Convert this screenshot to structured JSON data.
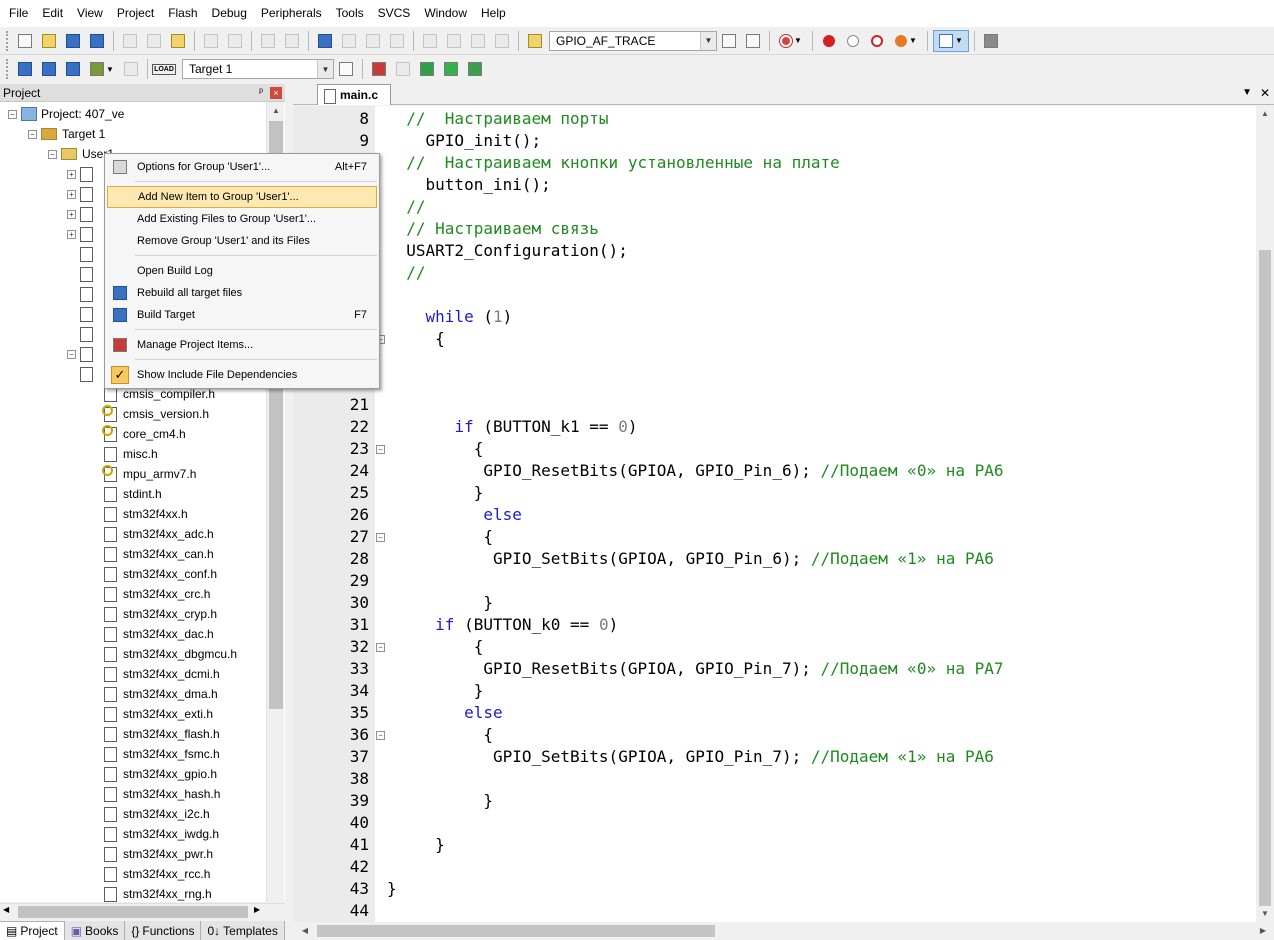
{
  "menu": [
    "File",
    "Edit",
    "View",
    "Project",
    "Flash",
    "Debug",
    "Peripherals",
    "Tools",
    "SVCS",
    "Window",
    "Help"
  ],
  "toolbar": {
    "find_combo": "GPIO_AF_TRACE",
    "target_combo": "Target 1",
    "load_label": "LOAD"
  },
  "project_panel": {
    "title": "Project",
    "pin_glyph": "ᵖ",
    "close_glyph": "×",
    "root": "Project: 407_ve",
    "target": "Target 1",
    "group": "User1",
    "files": [
      "cmsis_compiler.h",
      "cmsis_version.h",
      "core_cm4.h",
      "misc.h",
      "mpu_armv7.h",
      "stdint.h",
      "stm32f4xx.h",
      "stm32f4xx_adc.h",
      "stm32f4xx_can.h",
      "stm32f4xx_conf.h",
      "stm32f4xx_crc.h",
      "stm32f4xx_cryp.h",
      "stm32f4xx_dac.h",
      "stm32f4xx_dbgmcu.h",
      "stm32f4xx_dcmi.h",
      "stm32f4xx_dma.h",
      "stm32f4xx_exti.h",
      "stm32f4xx_flash.h",
      "stm32f4xx_fsmc.h",
      "stm32f4xx_gpio.h",
      "stm32f4xx_hash.h",
      "stm32f4xx_i2c.h",
      "stm32f4xx_iwdg.h",
      "stm32f4xx_pwr.h",
      "stm32f4xx_rcc.h",
      "stm32f4xx_rng.h"
    ],
    "tabs": [
      "Project",
      "Books",
      "Functions",
      "Templates"
    ],
    "tab_icons": [
      "▤",
      "▣",
      "{}",
      "0↓"
    ]
  },
  "context_menu": {
    "items": [
      {
        "label": "Options for Group 'User1'...",
        "shortcut": "Alt+F7",
        "icon": "wand-icon"
      },
      {
        "label": "Add New  Item to Group 'User1'...",
        "shortcut": "",
        "icon": ""
      },
      {
        "label": "Add Existing Files to Group 'User1'...",
        "shortcut": "",
        "icon": ""
      },
      {
        "label": "Remove Group 'User1' and its Files",
        "shortcut": "",
        "icon": ""
      },
      {
        "label": "Open Build Log",
        "shortcut": "",
        "icon": ""
      },
      {
        "label": "Rebuild all target files",
        "shortcut": "",
        "icon": "rebuild-icon"
      },
      {
        "label": "Build Target",
        "shortcut": "F7",
        "icon": "build-icon"
      },
      {
        "label": "Manage Project Items...",
        "shortcut": "",
        "icon": "manage-icon"
      },
      {
        "label": "Show Include File Dependencies",
        "shortcut": "",
        "icon": "check-icon"
      }
    ],
    "check_glyph": "✓"
  },
  "editor": {
    "tab": "main.c",
    "dropdown_glyph": "▼",
    "close_glyph": "✕",
    "scroll_glyphs": {
      "up": "▲",
      "down": "▼",
      "left": "◀",
      "right": "▶"
    },
    "lines": [
      {
        "n": "8",
        "fold": "",
        "parts": [
          {
            "t": "  //  Настраиваем порты",
            "c": "cm"
          }
        ]
      },
      {
        "n": "9",
        "fold": "",
        "parts": [
          {
            "t": "    GPIO_init();",
            "c": ""
          }
        ]
      },
      {
        "n": "",
        "fold": "",
        "parts": [
          {
            "t": "  //  Настраиваем кнопки установленные на плате",
            "c": "cm"
          }
        ]
      },
      {
        "n": "",
        "fold": "",
        "parts": [
          {
            "t": "    button_ini();",
            "c": ""
          }
        ]
      },
      {
        "n": "",
        "fold": "",
        "parts": [
          {
            "t": "  //",
            "c": "cm"
          }
        ]
      },
      {
        "n": "",
        "fold": "",
        "parts": [
          {
            "t": "  // Настраиваем связь",
            "c": "cm"
          }
        ]
      },
      {
        "n": "",
        "fold": "",
        "parts": [
          {
            "t": "  USART2_Configuration();",
            "c": ""
          }
        ]
      },
      {
        "n": "",
        "fold": "",
        "parts": [
          {
            "t": "  //",
            "c": "cm"
          }
        ]
      },
      {
        "n": "",
        "fold": "",
        "parts": [
          {
            "t": "",
            "c": ""
          }
        ]
      },
      {
        "n": "",
        "fold": "",
        "parts": [
          {
            "t": "    ",
            "c": ""
          },
          {
            "t": "while",
            "c": "kw"
          },
          {
            "t": " (",
            "c": ""
          },
          {
            "t": "1",
            "c": "nm"
          },
          {
            "t": ")",
            "c": ""
          }
        ]
      },
      {
        "n": "",
        "fold": "−",
        "parts": [
          {
            "t": "     {",
            "c": ""
          }
        ]
      },
      {
        "n": "",
        "fold": "",
        "parts": [
          {
            "t": "",
            "c": ""
          }
        ]
      },
      {
        "n": "",
        "fold": "",
        "parts": [
          {
            "t": "",
            "c": ""
          }
        ]
      },
      {
        "n": "21",
        "fold": "",
        "parts": [
          {
            "t": "",
            "c": ""
          }
        ]
      },
      {
        "n": "22",
        "fold": "",
        "parts": [
          {
            "t": "       ",
            "c": ""
          },
          {
            "t": "if",
            "c": "kw"
          },
          {
            "t": " (BUTTON_k1 == ",
            "c": ""
          },
          {
            "t": "0",
            "c": "nm"
          },
          {
            "t": ")",
            "c": ""
          }
        ]
      },
      {
        "n": "23",
        "fold": "−",
        "parts": [
          {
            "t": "         {",
            "c": ""
          }
        ]
      },
      {
        "n": "24",
        "fold": "",
        "parts": [
          {
            "t": "          GPIO_ResetBits(GPIOA, GPIO_Pin_6); ",
            "c": ""
          },
          {
            "t": "//Подаем «0» на PA6",
            "c": "cm"
          }
        ]
      },
      {
        "n": "25",
        "fold": "",
        "parts": [
          {
            "t": "         }",
            "c": ""
          }
        ]
      },
      {
        "n": "26",
        "fold": "",
        "parts": [
          {
            "t": "          ",
            "c": ""
          },
          {
            "t": "else",
            "c": "kw"
          }
        ]
      },
      {
        "n": "27",
        "fold": "−",
        "parts": [
          {
            "t": "          {",
            "c": ""
          }
        ]
      },
      {
        "n": "28",
        "fold": "",
        "parts": [
          {
            "t": "           GPIO_SetBits(GPIOA, GPIO_Pin_6); ",
            "c": ""
          },
          {
            "t": "//Подаем «1» на PA6",
            "c": "cm"
          }
        ]
      },
      {
        "n": "29",
        "fold": "",
        "parts": [
          {
            "t": "",
            "c": ""
          }
        ]
      },
      {
        "n": "30",
        "fold": "",
        "parts": [
          {
            "t": "          }",
            "c": ""
          }
        ]
      },
      {
        "n": "31",
        "fold": "",
        "parts": [
          {
            "t": "     ",
            "c": ""
          },
          {
            "t": "if",
            "c": "kw"
          },
          {
            "t": " (BUTTON_k0 == ",
            "c": ""
          },
          {
            "t": "0",
            "c": "nm"
          },
          {
            "t": ")",
            "c": ""
          }
        ]
      },
      {
        "n": "32",
        "fold": "−",
        "parts": [
          {
            "t": "         {",
            "c": ""
          }
        ]
      },
      {
        "n": "33",
        "fold": "",
        "parts": [
          {
            "t": "          GPIO_ResetBits(GPIOA, GPIO_Pin_7); ",
            "c": ""
          },
          {
            "t": "//Подаем «0» на PA7",
            "c": "cm"
          }
        ]
      },
      {
        "n": "34",
        "fold": "",
        "parts": [
          {
            "t": "         }",
            "c": ""
          }
        ]
      },
      {
        "n": "35",
        "fold": "",
        "parts": [
          {
            "t": "        ",
            "c": ""
          },
          {
            "t": "else",
            "c": "kw"
          }
        ]
      },
      {
        "n": "36",
        "fold": "−",
        "parts": [
          {
            "t": "          {",
            "c": ""
          }
        ]
      },
      {
        "n": "37",
        "fold": "",
        "parts": [
          {
            "t": "           GPIO_SetBits(GPIOA, GPIO_Pin_7); ",
            "c": ""
          },
          {
            "t": "//Подаем «1» на PA6",
            "c": "cm"
          }
        ]
      },
      {
        "n": "38",
        "fold": "",
        "parts": [
          {
            "t": "",
            "c": ""
          }
        ]
      },
      {
        "n": "39",
        "fold": "",
        "parts": [
          {
            "t": "          }",
            "c": ""
          }
        ]
      },
      {
        "n": "40",
        "fold": "",
        "parts": [
          {
            "t": "",
            "c": ""
          }
        ]
      },
      {
        "n": "41",
        "fold": "",
        "parts": [
          {
            "t": "     }",
            "c": ""
          }
        ]
      },
      {
        "n": "42",
        "fold": "",
        "parts": [
          {
            "t": "",
            "c": ""
          }
        ]
      },
      {
        "n": "43",
        "fold": "",
        "parts": [
          {
            "t": "}",
            "c": ""
          }
        ]
      },
      {
        "n": "44",
        "fold": "",
        "parts": [
          {
            "t": "",
            "c": ""
          }
        ]
      }
    ]
  }
}
